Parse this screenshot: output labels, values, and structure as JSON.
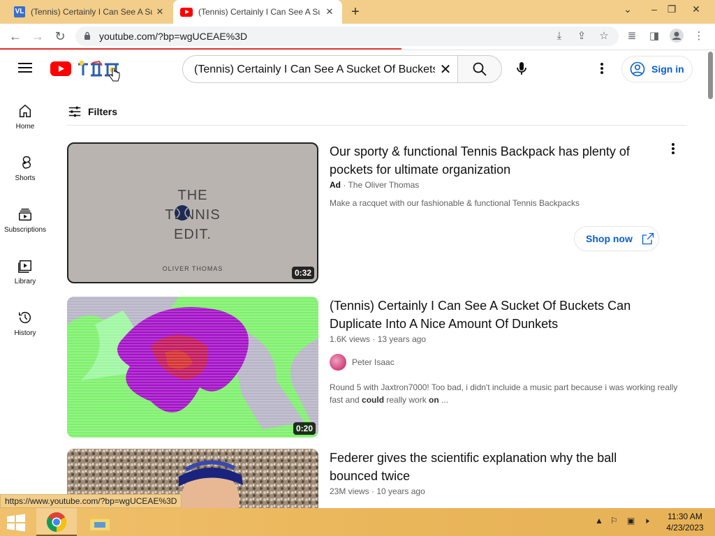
{
  "browser": {
    "tabs": [
      {
        "title": "(Tennis) Certainly I Can See A Sucket",
        "favicon": "vl-icon"
      },
      {
        "title": "(Tennis) Certainly I Can See A Sucket",
        "favicon": "youtube-icon"
      }
    ],
    "url": "youtube.com/?bp=wgUCEAE%3D",
    "status_url": "https://www.youtube.com/?bp=wgUCEAE%3D",
    "accent_loading_color": "#e53935"
  },
  "youtube": {
    "search_value": "(Tennis) Certainly I Can See A Sucket Of Buckets",
    "signin_label": "Sign in",
    "filters_label": "Filters",
    "sidebar": [
      {
        "label": "Home",
        "icon": "home-icon"
      },
      {
        "label": "Shorts",
        "icon": "shorts-icon"
      },
      {
        "label": "Subscriptions",
        "icon": "subscriptions-icon"
      },
      {
        "label": "Library",
        "icon": "library-icon"
      },
      {
        "label": "History",
        "icon": "history-icon"
      }
    ],
    "results": [
      {
        "title": "Our sporty & functional Tennis Backpack has plenty of pockets for ultimate organization",
        "badge": "Ad",
        "channel": "The Oliver Thomas",
        "description": "Make a racquet with our fashionable & functional Tennis Backpacks",
        "cta": "Shop now",
        "duration": "0:32",
        "thumb_text": [
          "THE",
          "TENNIS",
          "EDIT."
        ],
        "thumb_brand": "OLIVER THOMAS"
      },
      {
        "title": "(Tennis) Certainly I Can See A Sucket Of Buckets Can Duplicate Into A Nice Amount Of Dunkets",
        "views": "1.6K views",
        "age": "13 years ago",
        "channel": "Peter Isaac",
        "description_start": "Round 5 with Jaxtron7000! Too bad, i didn't incluide a music part because i was working really fast and ",
        "description_bold1": "could",
        "description_mid": " really work ",
        "description_bold2": "on",
        "description_end": " ...",
        "duration": "0:20"
      },
      {
        "title": "Federer gives the scientific explanation why the ball bounced twice",
        "views": "23M views",
        "age": "10 years ago"
      }
    ]
  },
  "taskbar": {
    "time": "11:30 AM",
    "date": "4/23/2023"
  }
}
